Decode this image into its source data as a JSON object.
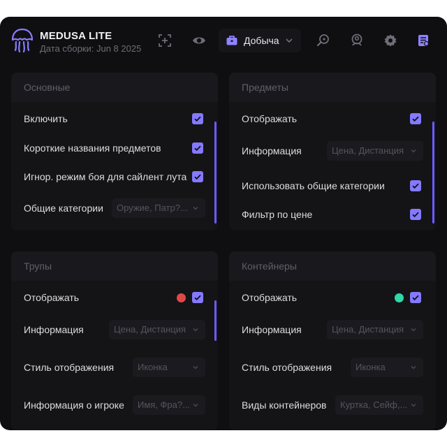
{
  "app": {
    "title": "MEDUSA LITE",
    "build": "Дата сборки: Jun 8 2025"
  },
  "toolbar": {
    "mode_label": "Добыча",
    "accent": "#8579ff"
  },
  "panels": {
    "basic": {
      "title": "Основные",
      "enable_label": "Включить",
      "short_names_label": "Короткие названия предметов",
      "ignore_combat_label": "Игнор. режим боя для сайлент лута",
      "common_categories_label": "Общие категории",
      "common_categories_value": "Оружие, Патр?..."
    },
    "items": {
      "title": "Предметы",
      "display_label": "Отображать",
      "info_label": "Информация",
      "info_value": "Цена, Дистанция",
      "use_common_label": "Использовать общие категории",
      "price_filter_label": "Фильтр по цене"
    },
    "corpses": {
      "title": "Трупы",
      "display_label": "Отображать",
      "dot_color": "#e04848",
      "info_label": "Информация",
      "info_value": "Цена, Дистанция",
      "style_label": "Стиль отображения",
      "style_value": "Иконка",
      "player_info_label": "Информация о игроке",
      "player_info_value": "Имя, Фра?..."
    },
    "containers": {
      "title": "Контейнеры",
      "display_label": "Отображать",
      "dot_color": "#2ed8a8",
      "info_label": "Информация",
      "info_value": "Цена, Дистанция",
      "style_label": "Стиль отображения",
      "style_value": "Иконка",
      "types_label": "Виды контейнеров",
      "types_value": "Куртка, Сейф,..."
    }
  }
}
